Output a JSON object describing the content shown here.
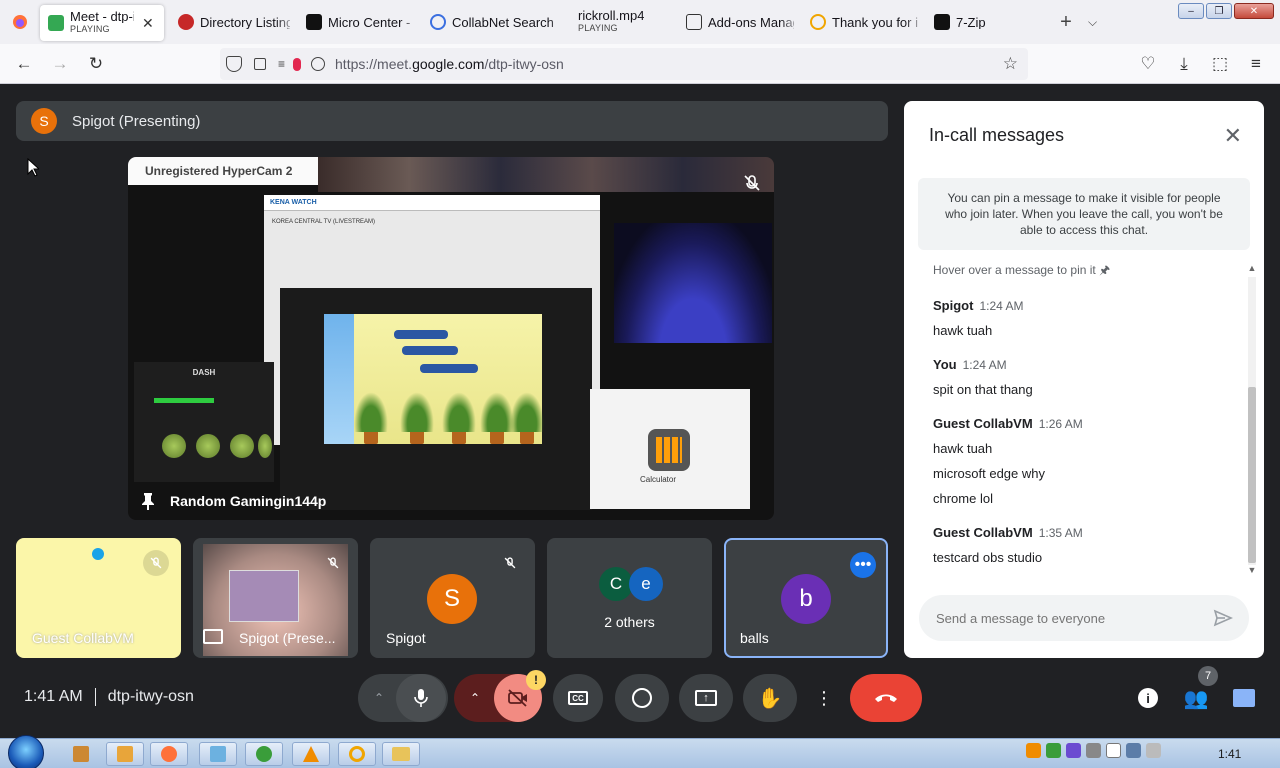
{
  "browser": {
    "tabs": [
      {
        "title": "Meet - dtp-itwy-osn",
        "sub": "PLAYING",
        "active": true,
        "color": "#34a853"
      },
      {
        "title": "Directory Listing",
        "sub": "",
        "color": "#c62828"
      },
      {
        "title": "Micro Center - I",
        "sub": "",
        "color": "#111111"
      },
      {
        "title": "CollabNet Search",
        "sub": "",
        "color": "#3b6fe0"
      },
      {
        "title": "rickroll.mp4",
        "sub": "PLAYING",
        "color": ""
      },
      {
        "title": "Add-ons Manager",
        "sub": "",
        "color": "#333333"
      },
      {
        "title": "Thank you for i",
        "sub": "",
        "color": "#f0a500"
      },
      {
        "title": "7-Zip",
        "sub": "",
        "color": "#111111"
      }
    ],
    "url_prefix": "https://meet.",
    "url_domain": "google.com",
    "url_path": "/dtp-itwy-osn"
  },
  "meet": {
    "presenter_initial": "S",
    "presenting_label": "Spigot (Presenting)",
    "screen": {
      "hypercam_label": "Unregistered HyperCam 2",
      "window_brand": "KENA WATCH",
      "window_headline": "KOREA CENTRAL TV (LIVESTREAM)",
      "dash_title": "DASH",
      "calc_label": "Calculator",
      "pinned_name": "Random Gamingin144p"
    },
    "tiles": [
      {
        "name": "Guest CollabVM"
      },
      {
        "name": "Spigot (Prese..."
      },
      {
        "name": "Spigot",
        "initial": "S"
      },
      {
        "name": "2 others",
        "initial_a": "C",
        "initial_b": "e"
      },
      {
        "name": "balls",
        "initial": "b"
      }
    ],
    "meeting_time": "1:41 AM",
    "meeting_code": "dtp-itwy-osn",
    "participants_count": "7",
    "warning_mark": "!"
  },
  "chat": {
    "title": "In-call messages",
    "pin_note": "You can pin a message to make it visible for people who join later. When you leave the call, you won't be able to access this chat.",
    "hover_note": "Hover over a message to pin it",
    "messages": [
      {
        "sender": "Spigot",
        "time": "1:24 AM",
        "lines": [
          "hawk tuah"
        ]
      },
      {
        "sender": "You",
        "time": "1:24 AM",
        "lines": [
          "spit on that thang"
        ]
      },
      {
        "sender": "Guest CollabVM",
        "time": "1:26 AM",
        "lines": [
          "hawk tuah",
          "microsoft edge why",
          "chrome lol"
        ]
      },
      {
        "sender": "Guest CollabVM",
        "time": "1:35 AM",
        "lines": [
          "testcard obs studio"
        ]
      }
    ],
    "input_placeholder": "Send a message to everyone"
  },
  "taskbar": {
    "clock": "1:41"
  }
}
